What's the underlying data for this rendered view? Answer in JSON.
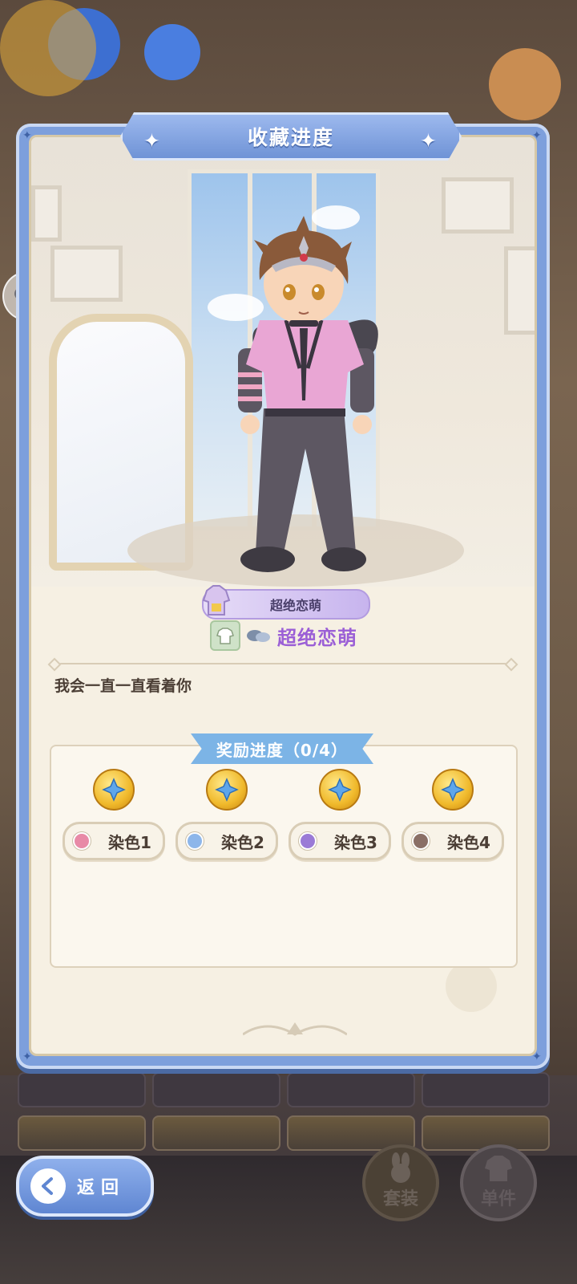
{
  "header": {
    "title": "收藏进度"
  },
  "item": {
    "name_pill": "超绝恋萌",
    "set_name": "超绝恋萌"
  },
  "description": "我会一直一直看着你",
  "rewards": {
    "title": "奖励进度（0/4）",
    "items": [
      {
        "label": "染色1",
        "color": "#e88aa7"
      },
      {
        "label": "染色2",
        "color": "#8db6ea"
      },
      {
        "label": "染色3",
        "color": "#9a7ad6"
      },
      {
        "label": "染色4",
        "color": "#8a6f66"
      }
    ]
  },
  "footer": {
    "back_label": "返回",
    "suit_label": "套装",
    "single_label": "单件"
  },
  "colors": {
    "panel_blue": "#7d9fdc",
    "set_name_purple": "#9b5fd6",
    "reward_tab_blue": "#7cb4e6"
  }
}
